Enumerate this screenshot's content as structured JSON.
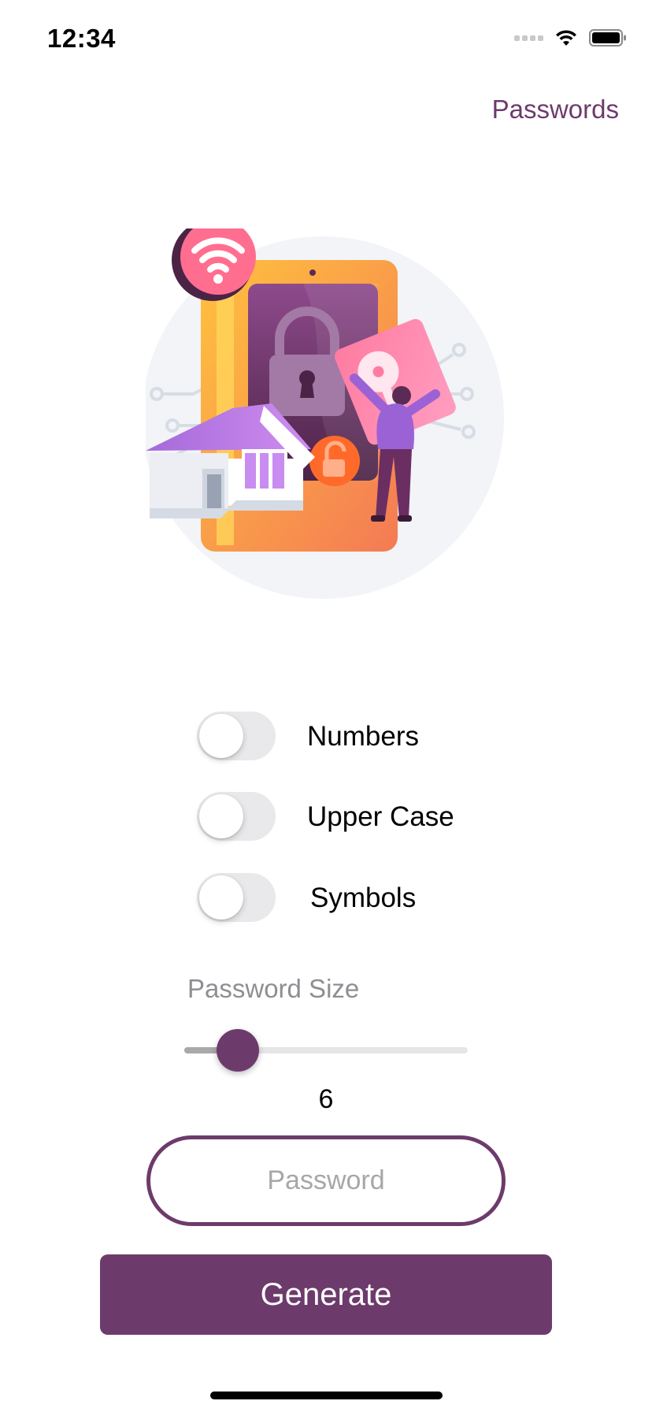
{
  "status_bar": {
    "time": "12:34",
    "icons": [
      "cellular-signal-icon",
      "wifi-icon",
      "battery-icon"
    ]
  },
  "nav": {
    "passwords_link": "Passwords"
  },
  "hero": {
    "icon": "security-illustration-icon"
  },
  "options": {
    "items": [
      {
        "label": "Numbers",
        "on": false
      },
      {
        "label": "Upper Case",
        "on": false
      },
      {
        "label": "Symbols",
        "on": false
      }
    ]
  },
  "size": {
    "label": "Password Size",
    "value": "6",
    "slider_fraction": 0.19
  },
  "password": {
    "placeholder": "Password",
    "value": ""
  },
  "actions": {
    "generate_label": "Generate"
  },
  "colors": {
    "accent": "#6d3b6b",
    "toggle_off": "#e9e9eb",
    "muted_text": "#8e8e93",
    "background": "#ffffff"
  }
}
